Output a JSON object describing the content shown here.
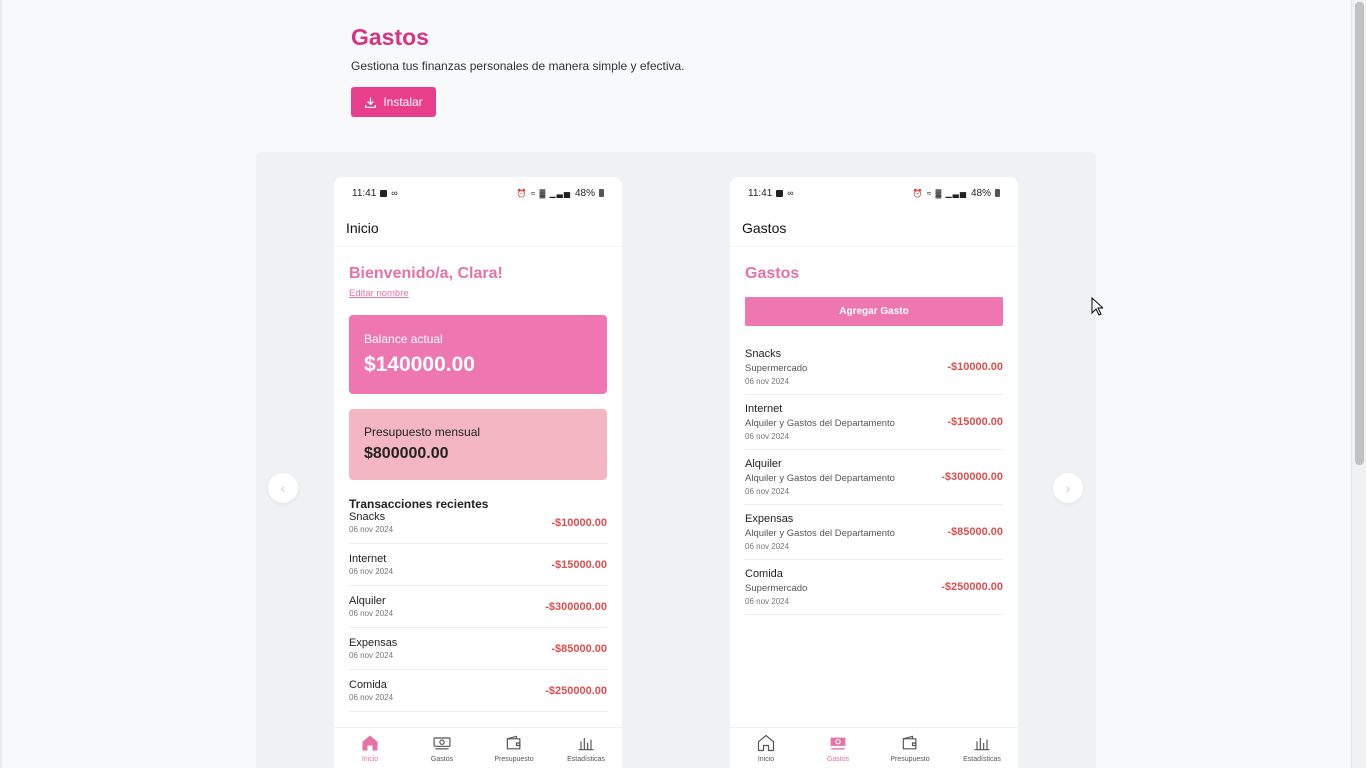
{
  "header": {
    "title": "Gastos",
    "subtitle": "Gestiona tus finanzas personales de manera simple y efectiva.",
    "install_label": "Instalar"
  },
  "colors": {
    "accent": "#e83e8c",
    "pink_light": "#ee77b2",
    "pink_pale": "#f4b6c2",
    "negative": "#dc4f4f"
  },
  "status": {
    "time": "11:41",
    "battery": "48%"
  },
  "screen1": {
    "appbar_title": "Inicio",
    "welcome": "Bienvenido/a, Clara!",
    "edit_name": "Editar nombre",
    "balance_label": "Balance actual",
    "balance_value": "$140000.00",
    "budget_label": "Presupuesto mensual",
    "budget_value": "$800000.00",
    "recent_title": "Transacciones recientes",
    "transactions": [
      {
        "name": "Snacks",
        "date": "06 nov 2024",
        "amount": "-$10000.00"
      },
      {
        "name": "Internet",
        "date": "06 nov 2024",
        "amount": "-$15000.00"
      },
      {
        "name": "Alquiler",
        "date": "06 nov 2024",
        "amount": "-$300000.00"
      },
      {
        "name": "Expensas",
        "date": "06 nov 2024",
        "amount": "-$85000.00"
      },
      {
        "name": "Comida",
        "date": "06 nov 2024",
        "amount": "-$250000.00"
      }
    ]
  },
  "screen2": {
    "appbar_title": "Gastos",
    "section_title": "Gastos",
    "add_button": "Agregar Gasto",
    "expenses": [
      {
        "name": "Snacks",
        "category": "Supermercado",
        "date": "06 nov 2024",
        "amount": "-$10000.00"
      },
      {
        "name": "Internet",
        "category": "Alquiler y Gastos del Departamento",
        "date": "06 nov 2024",
        "amount": "-$15000.00"
      },
      {
        "name": "Alquiler",
        "category": "Alquiler y Gastos del Departamento",
        "date": "06 nov 2024",
        "amount": "-$300000.00"
      },
      {
        "name": "Expensas",
        "category": "Alquiler y Gastos del Departamento",
        "date": "06 nov 2024",
        "amount": "-$85000.00"
      },
      {
        "name": "Comida",
        "category": "Supermercado",
        "date": "06 nov 2024",
        "amount": "-$250000.00"
      }
    ]
  },
  "nav": [
    {
      "label": "Inicio",
      "icon": "home-icon"
    },
    {
      "label": "Gastos",
      "icon": "money-icon"
    },
    {
      "label": "Presupuesto",
      "icon": "wallet-icon"
    },
    {
      "label": "Estadísticas",
      "icon": "bar-chart-icon"
    }
  ]
}
